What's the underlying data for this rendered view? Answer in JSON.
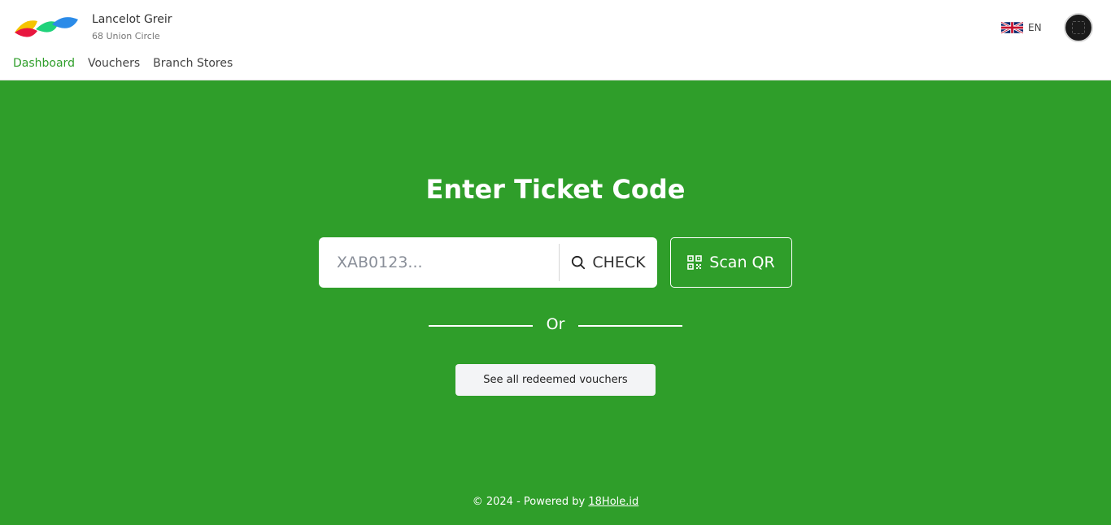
{
  "header": {
    "user_name": "Lancelot Greir",
    "address": "68 Union Circle",
    "language": "EN",
    "flag_icon": "uk-flag-icon",
    "logo_colors": [
      "#f5c400",
      "#e8173f",
      "#1fd27a",
      "#2b8be8"
    ]
  },
  "nav": {
    "items": [
      {
        "label": "Dashboard",
        "active": true
      },
      {
        "label": "Vouchers",
        "active": false
      },
      {
        "label": "Branch Stores",
        "active": false
      }
    ]
  },
  "main": {
    "title": "Enter Ticket Code",
    "input_placeholder": "XAB0123...",
    "check_label": "CHECK",
    "scan_label": "Scan QR",
    "or_label": "Or",
    "redeemed_label": "See all redeemed vouchers"
  },
  "footer": {
    "text": "© 2024 - Powered by ",
    "link": "18Hole.id"
  },
  "colors": {
    "accent": "#2f9e2a",
    "header_bg": "#ffffff"
  }
}
